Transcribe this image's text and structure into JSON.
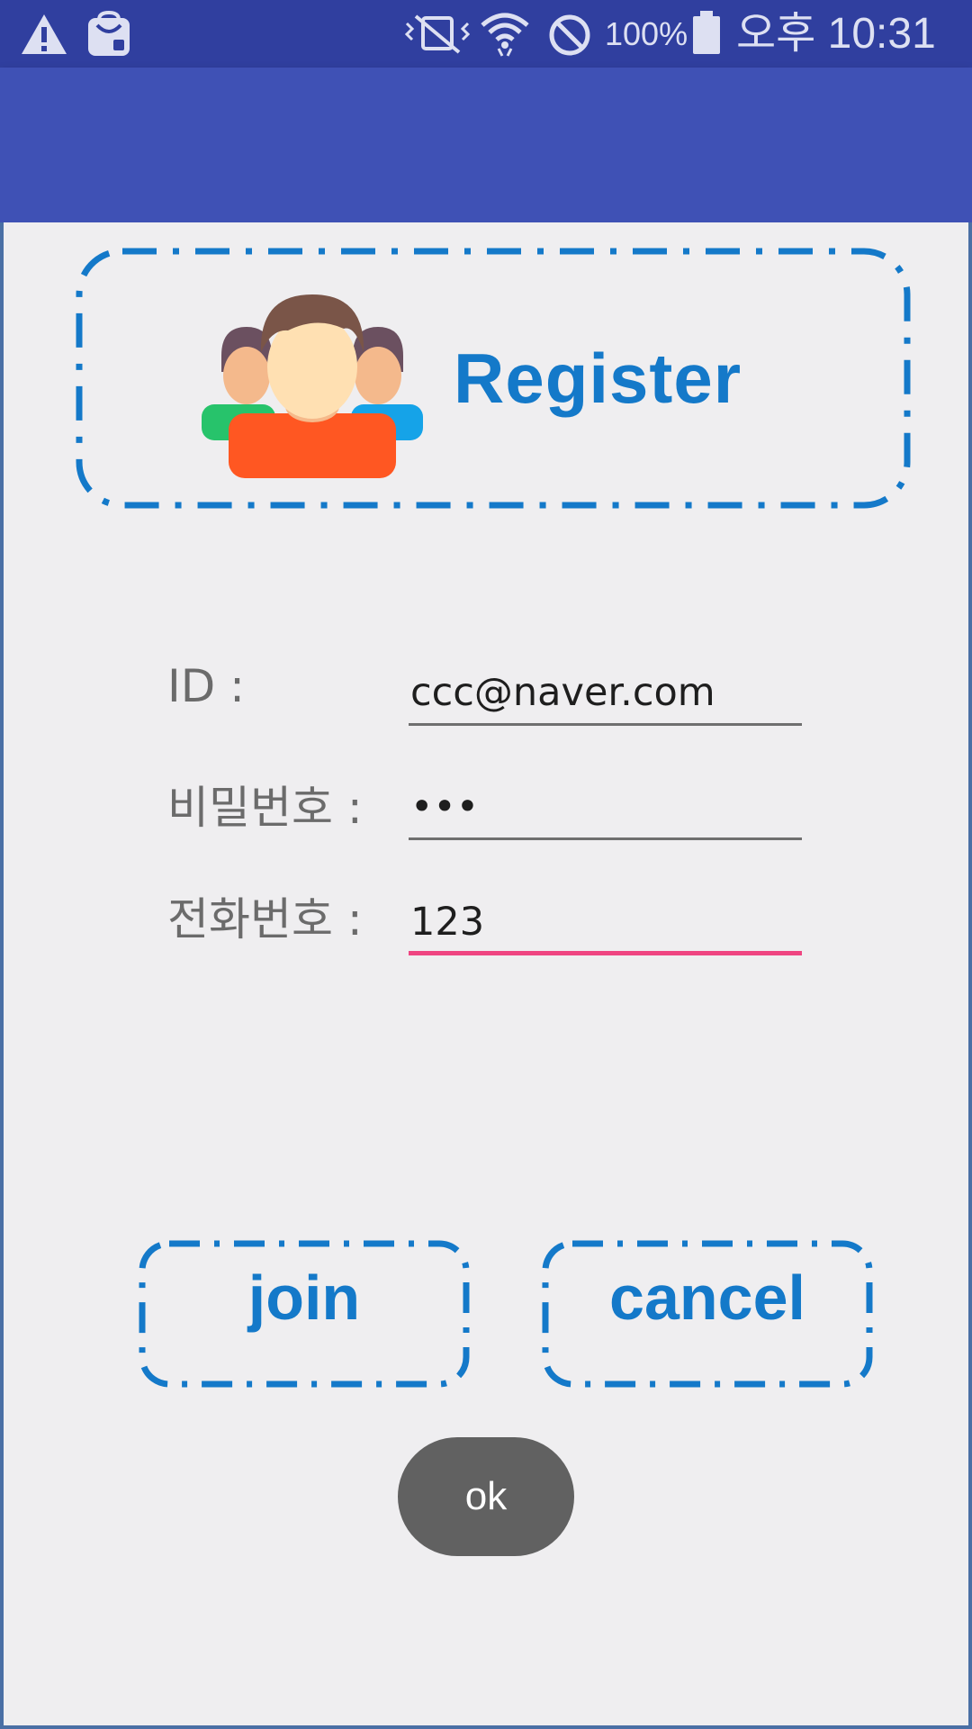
{
  "status_bar": {
    "battery": "100%",
    "time": "오후 10:31",
    "icons": [
      "warning-icon",
      "shopping-bag-icon",
      "vibrate-mute-icon",
      "wifi-icon",
      "do-not-disturb-icon",
      "battery-icon"
    ]
  },
  "header": {
    "title": "Register",
    "icon": "user-group-icon"
  },
  "form": {
    "fields": [
      {
        "label": "ID :",
        "value": "ccc@naver.com"
      },
      {
        "label": "비밀번호 :",
        "value": "•••"
      },
      {
        "label": "전화번호 :",
        "value": "123"
      }
    ]
  },
  "buttons": {
    "join": "join",
    "cancel": "cancel",
    "ok": "ok"
  },
  "colors": {
    "status_bar": "#303f9f",
    "app_bar": "#3f51b5",
    "accent_blue": "#1479c9",
    "focus_underline": "#ef4581",
    "ok_button": "#616161",
    "background": "#efeef0"
  }
}
